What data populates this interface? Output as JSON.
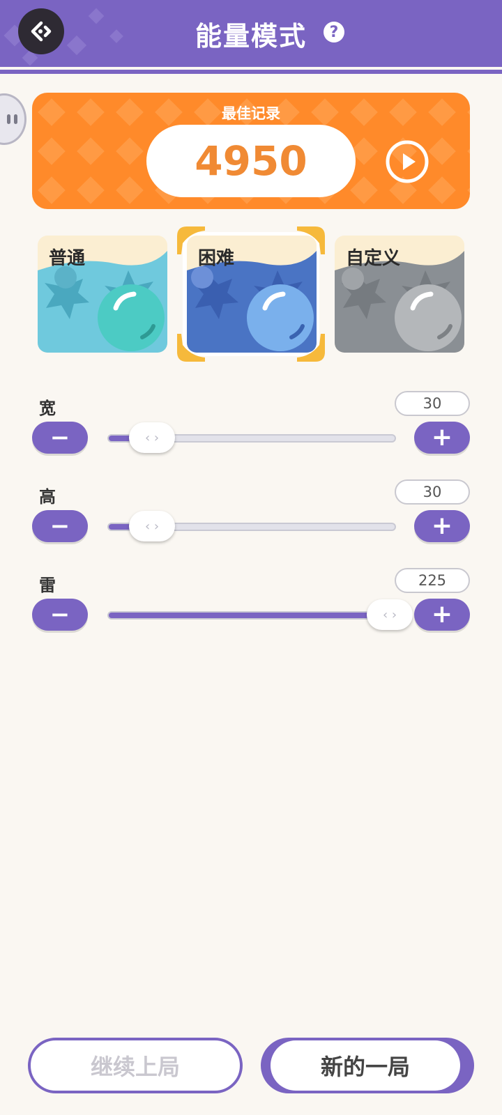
{
  "header": {
    "title": "能量模式",
    "back_icon": "back-arrow-icon",
    "help_glyph": "?"
  },
  "record": {
    "label": "最佳记录",
    "value": "4950",
    "play_icon": "play-icon"
  },
  "modes": [
    {
      "label": "普通",
      "selected": false,
      "color": "#6fc9dd"
    },
    {
      "label": "困难",
      "selected": true,
      "color": "#4a74c4"
    },
    {
      "label": "自定义",
      "selected": false,
      "color": "#8a8f94"
    }
  ],
  "sliders": [
    {
      "label": "宽",
      "value": "30",
      "fill_fraction": 0.08
    },
    {
      "label": "高",
      "value": "30",
      "fill_fraction": 0.08
    },
    {
      "label": "雷",
      "value": "225",
      "fill_fraction": 0.94
    }
  ],
  "buttons": {
    "minus": "−",
    "plus": "+",
    "thumb": "‹ ›",
    "continue": "继续上局",
    "new_game": "新的一局"
  },
  "colors": {
    "accent": "#7a64c2",
    "record": "#ff8a2a",
    "record_value": "#f08a34"
  }
}
